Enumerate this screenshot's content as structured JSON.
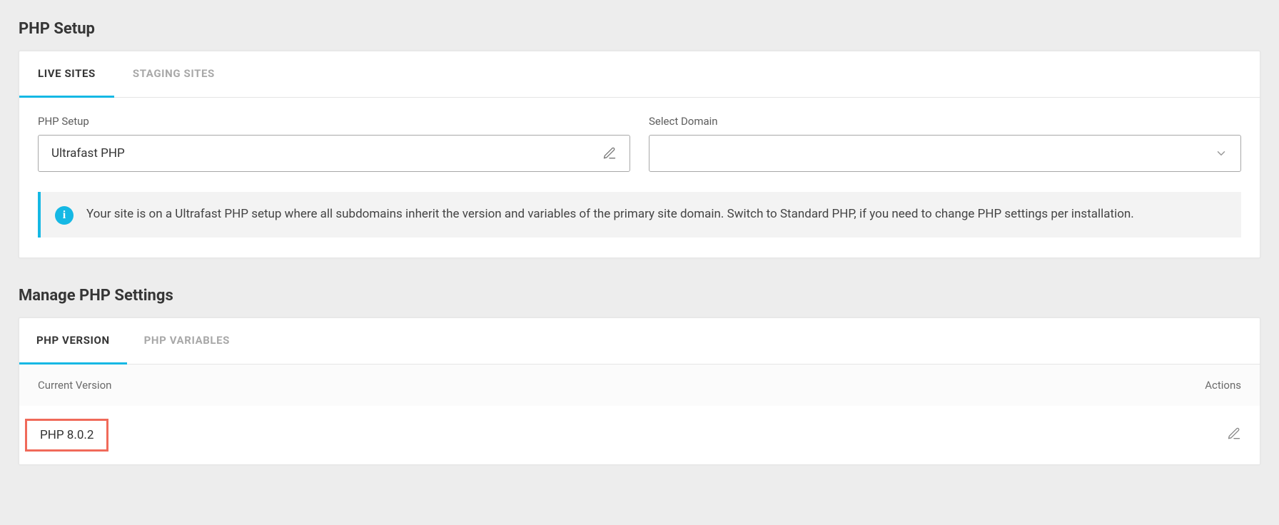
{
  "php_setup": {
    "heading": "PHP Setup",
    "tabs": [
      {
        "label": "LIVE SITES",
        "active": true
      },
      {
        "label": "STAGING SITES",
        "active": false
      }
    ],
    "form": {
      "setup_label": "PHP Setup",
      "setup_value": "Ultrafast PHP",
      "domain_label": "Select Domain",
      "domain_value": ""
    },
    "info_text": "Your site is on a Ultrafast PHP setup where all subdomains inherit the version and variables of the primary site domain. Switch to Standard PHP, if you need to change PHP settings per installation."
  },
  "manage": {
    "heading": "Manage PHP Settings",
    "tabs": [
      {
        "label": "PHP VERSION",
        "active": true
      },
      {
        "label": "PHP VARIABLES",
        "active": false
      }
    ],
    "columns": {
      "version": "Current Version",
      "actions": "Actions"
    },
    "current_version": "PHP 8.0.2"
  }
}
